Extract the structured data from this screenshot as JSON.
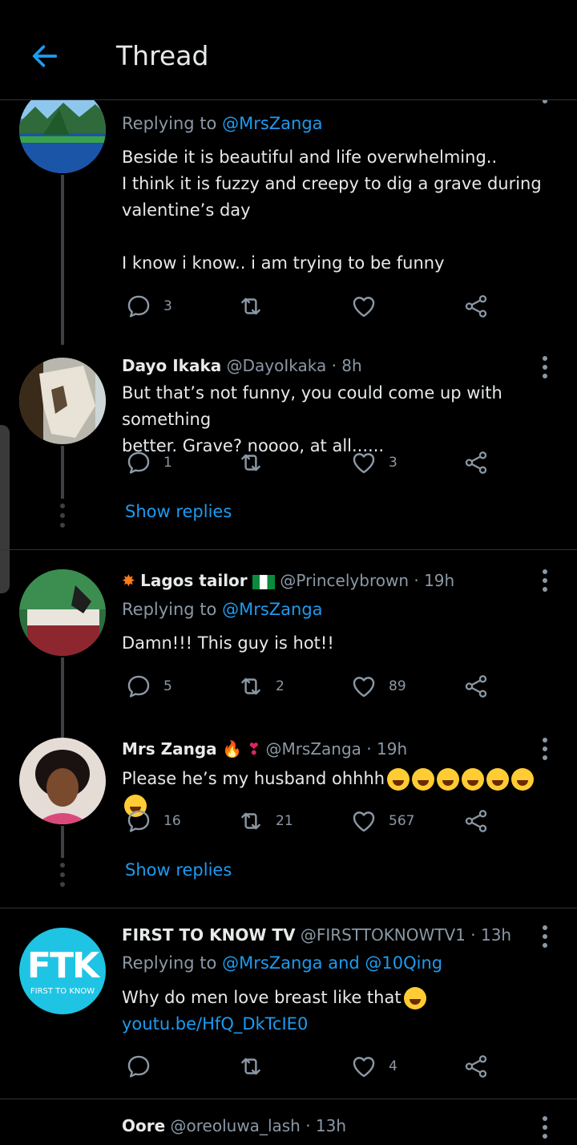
{
  "header": {
    "title": "Thread"
  },
  "tweets": [
    {
      "reply_prefix": "Replying to ",
      "reply_to": "@MrsZanga",
      "lines": [
        "Beside it is beautiful and life overwhelming..",
        "I think it is fuzzy and creepy to dig a grave during",
        "valentine’s day",
        "",
        "I know i know.. i am trying to be funny"
      ],
      "replies": "3",
      "retweets": "",
      "likes": ""
    },
    {
      "name": "Dayo Ikaka",
      "handle": "@DayoIkaka · 8h",
      "lines": [
        "But that’s not funny, you could come up with something",
        "better. Grave? noooo, at all......"
      ],
      "replies": "1",
      "retweets": "",
      "likes": "3",
      "show_replies": "Show replies"
    },
    {
      "name": "Lagos tailor",
      "handle": "@Princelybrown · 19h",
      "reply_prefix": "Replying to ",
      "reply_to": "@MrsZanga",
      "text": "Damn!!! This guy is hot!!",
      "replies": "5",
      "retweets": "2",
      "likes": "89"
    },
    {
      "name": "Mrs Zanga",
      "handle": "@MrsZanga · 19h",
      "text": "Please he’s my husband ohhhh",
      "replies": "16",
      "retweets": "21",
      "likes": "567",
      "show_replies": "Show replies"
    },
    {
      "name": "FIRST TO KNOW TV",
      "handle": "@FIRSTTOKNOWTV1 · 13h",
      "reply_prefix": "Replying to ",
      "reply_to": "@MrsZanga and @10Qing",
      "text": "Why do men love breast like that",
      "link": "youtu.be/HfQ_DkTcIE0",
      "avatar_big": "FTK",
      "avatar_small": "FIRST TO KNOW",
      "replies": "",
      "retweets": "",
      "likes": "4"
    },
    {
      "name": "Oore",
      "handle": "@oreoluwa_lash · 13h"
    }
  ],
  "colors": {
    "accent": "#1d9bf0",
    "muted": "#8b98a5",
    "background": "#000000"
  },
  "icons": [
    "back-arrow-icon",
    "reply-icon",
    "retweet-icon",
    "like-icon",
    "share-icon",
    "more-icon"
  ]
}
